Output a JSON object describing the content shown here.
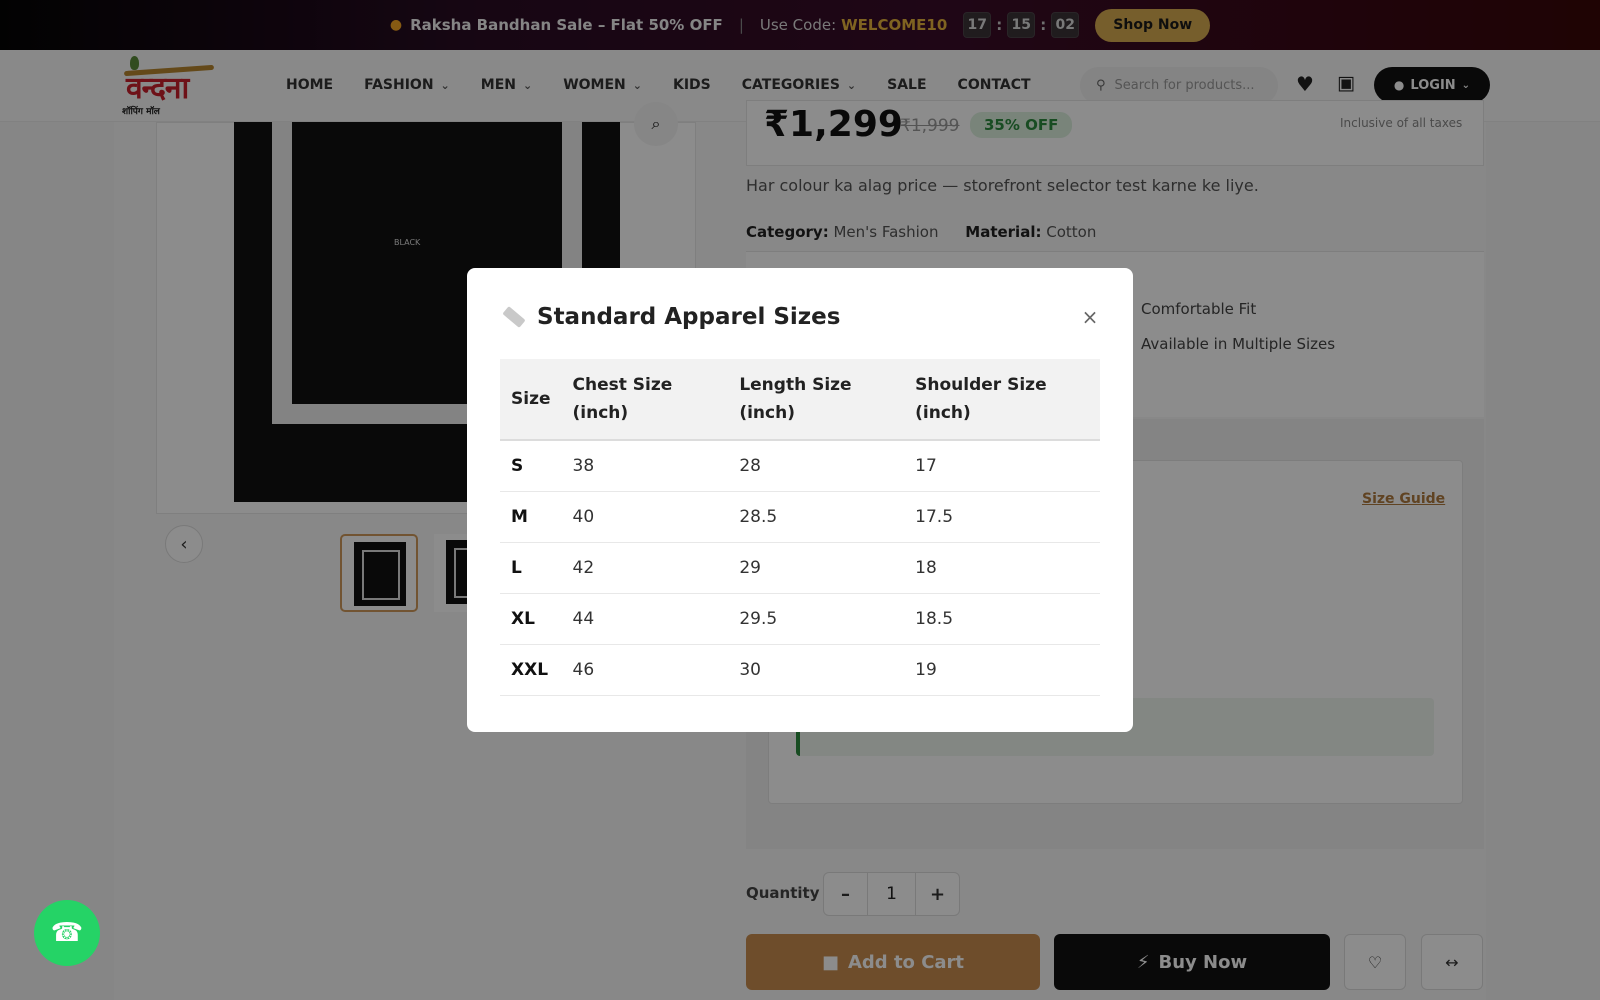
{
  "promo": {
    "sale_text": "Raksha Bandhan Sale – Flat 50% OFF",
    "separator": "|",
    "code_label": "Use Code:",
    "code": "WELCOME10",
    "timer": {
      "hours": "17",
      "minutes": "15",
      "seconds": "02"
    },
    "cta": "Shop Now"
  },
  "header": {
    "logo_text": "वन्दना",
    "logo_sub": "शॉपिंग मॉल",
    "nav": [
      {
        "label": "HOME",
        "dropdown": false
      },
      {
        "label": "FASHION",
        "dropdown": true
      },
      {
        "label": "MEN",
        "dropdown": true
      },
      {
        "label": "WOMEN",
        "dropdown": true
      },
      {
        "label": "KIDS",
        "dropdown": false
      },
      {
        "label": "CATEGORIES",
        "dropdown": true
      },
      {
        "label": "SALE",
        "dropdown": false
      },
      {
        "label": "CONTACT",
        "dropdown": false
      }
    ],
    "search_placeholder": "Search for products...",
    "login_label": "LOGIN"
  },
  "product": {
    "image_label": "BLACK",
    "price": "₹1,299",
    "mrp": "₹1,999",
    "discount": "35% OFF",
    "tax_note": "Inclusive of all taxes",
    "description": "Har colour ka alag price — storefront selector test karne ke liye.",
    "category_label": "Category:",
    "category_value": "Men's Fashion",
    "material_label": "Material:",
    "material_value": "Cotton",
    "features": [
      "Comfortable Fit",
      "Available in Multiple Sizes"
    ],
    "size_guide_link": "Size Guide",
    "quantity_label": "Quantity",
    "quantity_value": "1",
    "add_to_cart": "Add to Cart",
    "buy_now": "Buy Now"
  },
  "modal": {
    "title": "Standard Apparel Sizes",
    "close_symbol": "×",
    "columns": [
      "Size",
      "Chest Size (inch)",
      "Length Size (inch)",
      "Shoulder Size (inch)"
    ],
    "rows": [
      [
        "S",
        "38",
        "28",
        "17"
      ],
      [
        "M",
        "40",
        "28.5",
        "17.5"
      ],
      [
        "L",
        "42",
        "29",
        "18"
      ],
      [
        "XL",
        "44",
        "29.5",
        "18.5"
      ],
      [
        "XXL",
        "46",
        "30",
        "19"
      ]
    ]
  },
  "icons": {
    "fire": "fire-icon",
    "search": "search-icon",
    "wishlist": "heart-icon",
    "cart": "bag-icon",
    "user": "user-icon",
    "whatsapp": "whatsapp-icon"
  }
}
